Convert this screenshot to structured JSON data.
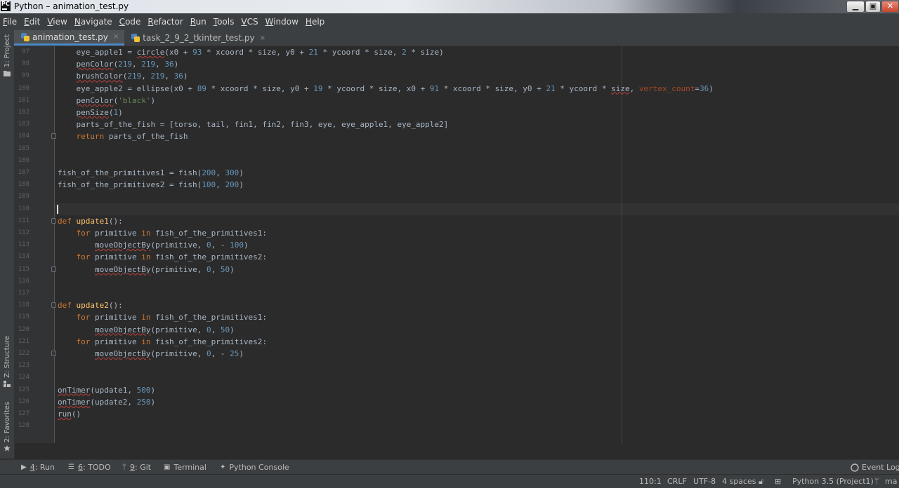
{
  "window": {
    "title": "Python – animation_test.py",
    "logo": "PC"
  },
  "menu": [
    "File",
    "Edit",
    "View",
    "Navigate",
    "Code",
    "Refactor",
    "Run",
    "Tools",
    "VCS",
    "Window",
    "Help"
  ],
  "tabs": [
    {
      "label": "animation_test.py",
      "active": true,
      "close": "×"
    },
    {
      "label": "task_2_9_2_tkinter_test.py",
      "active": false,
      "close": "×"
    }
  ],
  "left_tools": {
    "project": "1: Project",
    "structure": "Z: Structure",
    "favorites": "2: Favorites"
  },
  "editor": {
    "current_line": 110,
    "lines": [
      {
        "n": "97",
        "code": "    eye_apple1 = circle(x0 + 93 * xcoord * size, y0 + 21 * ycoord * size, 2 * size)"
      },
      {
        "n": "98",
        "code": "    penColor(219, 219, 36)"
      },
      {
        "n": "99",
        "code": "    brushColor(219, 219, 36)"
      },
      {
        "n": "100",
        "code": "    eye_apple2 = ellipse(x0 + 89 * xcoord * size, y0 + 19 * ycoord * size, x0 + 91 * xcoord * size, y0 + 21 * ycoord * size, vertex_count=36)"
      },
      {
        "n": "101",
        "code": "    penColor('black')"
      },
      {
        "n": "102",
        "code": "    penSize(1)"
      },
      {
        "n": "103",
        "code": "    parts_of_the_fish = [torso, tail, fin1, fin2, fin3, eye, eye_apple1, eye_apple2]"
      },
      {
        "n": "104",
        "code": "    return parts_of_the_fish"
      },
      {
        "n": "105",
        "code": ""
      },
      {
        "n": "106",
        "code": ""
      },
      {
        "n": "107",
        "code": "fish_of_the_primitives1 = fish(200, 300)"
      },
      {
        "n": "108",
        "code": "fish_of_the_primitives2 = fish(100, 200)"
      },
      {
        "n": "109",
        "code": ""
      },
      {
        "n": "110",
        "code": ""
      },
      {
        "n": "111",
        "code": "def update1():"
      },
      {
        "n": "112",
        "code": "    for primitive in fish_of_the_primitives1:"
      },
      {
        "n": "113",
        "code": "        moveObjectBy(primitive, 0, - 100)"
      },
      {
        "n": "114",
        "code": "    for primitive in fish_of_the_primitives2:"
      },
      {
        "n": "115",
        "code": "        moveObjectBy(primitive, 0, 50)"
      },
      {
        "n": "116",
        "code": ""
      },
      {
        "n": "117",
        "code": ""
      },
      {
        "n": "118",
        "code": "def update2():"
      },
      {
        "n": "119",
        "code": "    for primitive in fish_of_the_primitives1:"
      },
      {
        "n": "120",
        "code": "        moveObjectBy(primitive, 0, 50)"
      },
      {
        "n": "121",
        "code": "    for primitive in fish_of_the_primitives2:"
      },
      {
        "n": "122",
        "code": "        moveObjectBy(primitive, 0, - 25)"
      },
      {
        "n": "123",
        "code": ""
      },
      {
        "n": "124",
        "code": ""
      },
      {
        "n": "125",
        "code": "onTimer(update1, 500)"
      },
      {
        "n": "126",
        "code": "onTimer(update2, 250)"
      },
      {
        "n": "127",
        "code": "run()"
      },
      {
        "n": "128",
        "code": ""
      }
    ]
  },
  "tool_windows": [
    {
      "num": "4",
      "label": ": Run",
      "icon": "play-icon"
    },
    {
      "num": "6",
      "label": ": TODO",
      "icon": "list-icon"
    },
    {
      "num": "9",
      "label": ": Git",
      "icon": "branch-icon"
    },
    {
      "num": "",
      "label": "Terminal",
      "icon": "terminal-icon"
    },
    {
      "num": "",
      "label": "Python Console",
      "icon": "python-icon"
    }
  ],
  "event_log": "Event Log",
  "status": {
    "position": "110:1",
    "line_sep": "CRLF",
    "encoding": "UTF-8",
    "indent": "4 spaces",
    "interpreter": "Python 3.5 (Project1)",
    "branch": "ma"
  },
  "colors": {
    "background": "#2b2b2b",
    "keyword": "#cc7832",
    "number": "#6897bb",
    "string": "#6a8759",
    "function_def": "#ffc66d",
    "param": "#aa4926"
  }
}
